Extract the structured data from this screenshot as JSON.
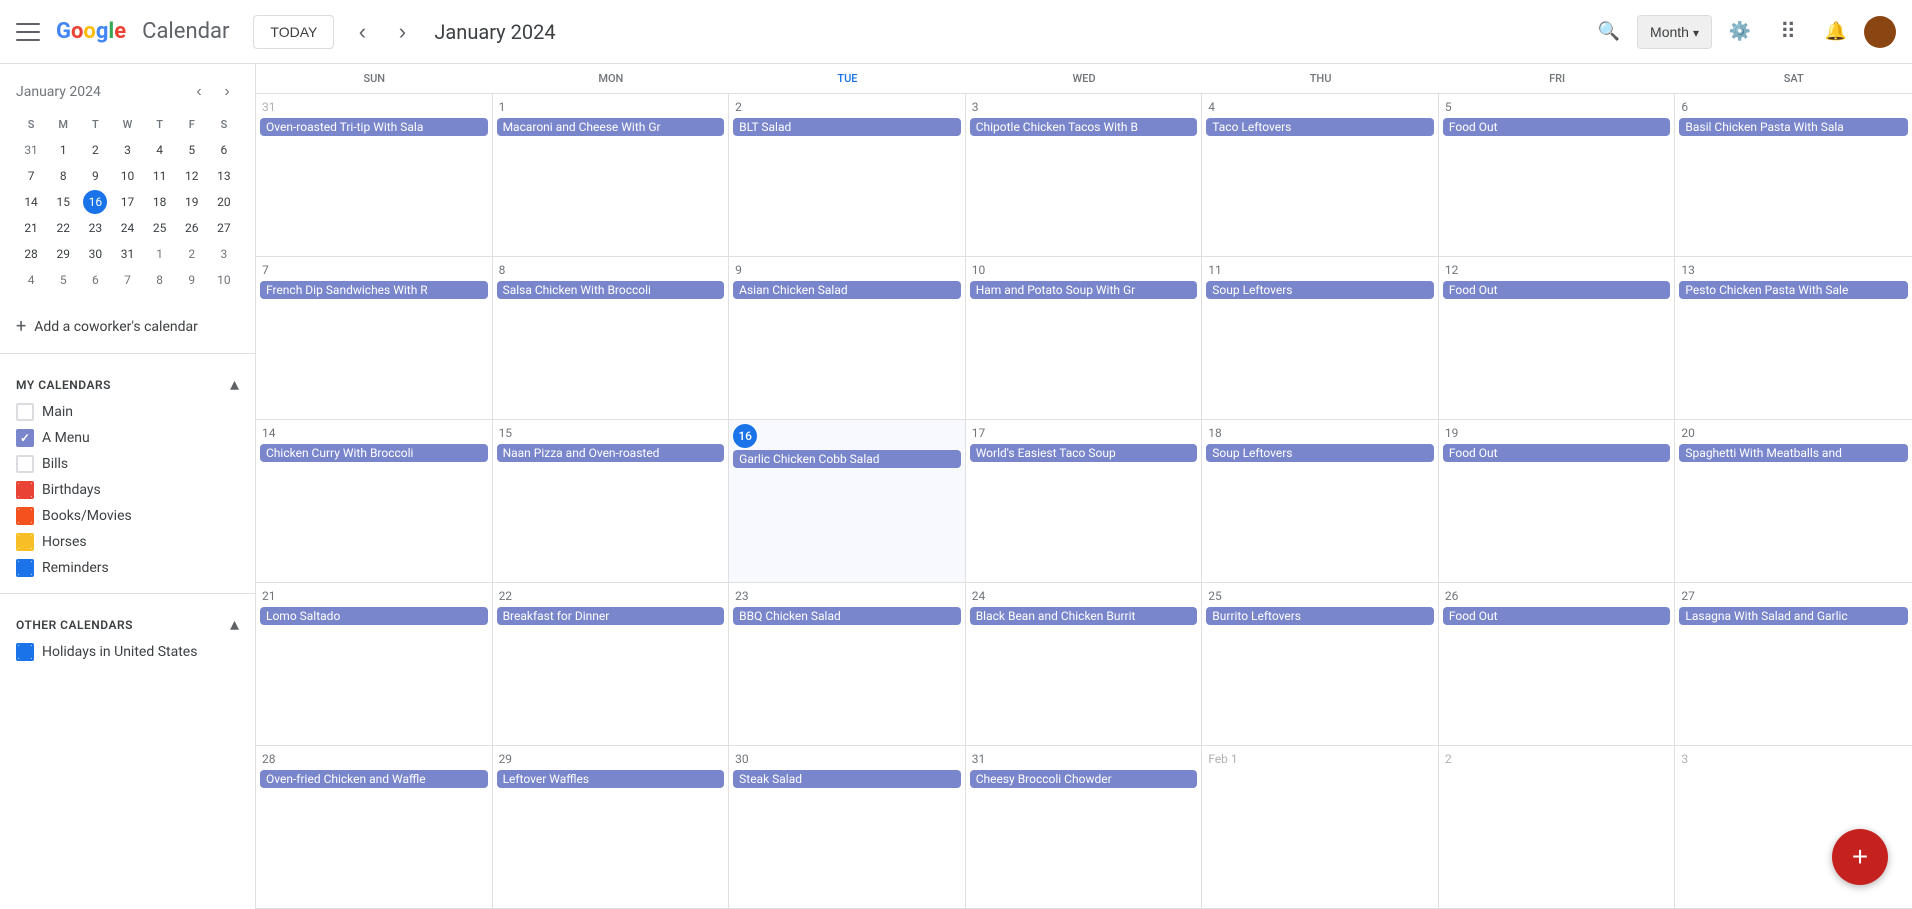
{
  "app": {
    "name": "Calendar",
    "today_btn": "TODAY"
  },
  "header": {
    "month_selector": "Month",
    "month_dropdown_arrow": "▾"
  },
  "mini_calendar": {
    "title": "January 2024",
    "days_of_week": [
      "S",
      "M",
      "T",
      "W",
      "T",
      "F",
      "S"
    ],
    "weeks": [
      [
        {
          "num": "31",
          "other": true
        },
        {
          "num": "1"
        },
        {
          "num": "2"
        },
        {
          "num": "3"
        },
        {
          "num": "4"
        },
        {
          "num": "5"
        },
        {
          "num": "6"
        }
      ],
      [
        {
          "num": "7"
        },
        {
          "num": "8"
        },
        {
          "num": "9"
        },
        {
          "num": "10"
        },
        {
          "num": "11"
        },
        {
          "num": "12"
        },
        {
          "num": "13"
        }
      ],
      [
        {
          "num": "14"
        },
        {
          "num": "15"
        },
        {
          "num": "16",
          "today": true
        },
        {
          "num": "17"
        },
        {
          "num": "18"
        },
        {
          "num": "19"
        },
        {
          "num": "20"
        }
      ],
      [
        {
          "num": "21"
        },
        {
          "num": "22"
        },
        {
          "num": "23"
        },
        {
          "num": "24"
        },
        {
          "num": "25"
        },
        {
          "num": "26"
        },
        {
          "num": "27"
        }
      ],
      [
        {
          "num": "28"
        },
        {
          "num": "29"
        },
        {
          "num": "30"
        },
        {
          "num": "31"
        },
        {
          "num": "1",
          "other": true
        },
        {
          "num": "2",
          "other": true
        },
        {
          "num": "3",
          "other": true
        }
      ],
      [
        {
          "num": "4",
          "other": true
        },
        {
          "num": "5",
          "other": true
        },
        {
          "num": "6",
          "other": true
        },
        {
          "num": "7",
          "other": true
        },
        {
          "num": "8",
          "other": true
        },
        {
          "num": "9",
          "other": true
        },
        {
          "num": "10",
          "other": true
        }
      ]
    ]
  },
  "add_coworker_label": "Add a coworker's calendar",
  "my_calendars": {
    "section_title": "My calendars",
    "items": [
      {
        "label": "Main",
        "checked": false,
        "color": "blue"
      },
      {
        "label": "A Menu",
        "checked": true,
        "color": "purple"
      },
      {
        "label": "Bills",
        "checked": false,
        "color": "none"
      },
      {
        "label": "Birthdays",
        "checked": false,
        "color": "red"
      },
      {
        "label": "Books/Movies",
        "checked": false,
        "color": "orange"
      },
      {
        "label": "Horses",
        "checked": false,
        "color": "yellow"
      },
      {
        "label": "Reminders",
        "checked": false,
        "color": "blue2"
      }
    ]
  },
  "other_calendars": {
    "section_title": "Other calendars",
    "items": [
      {
        "label": "Holidays in United States",
        "checked": false,
        "color": "blue2"
      }
    ]
  },
  "calendar": {
    "month_label": "January 2024",
    "days_of_week": [
      {
        "label": "Sun",
        "today": false
      },
      {
        "label": "Mon",
        "today": false
      },
      {
        "label": "Tue",
        "today": true
      },
      {
        "label": "Wed",
        "today": false
      },
      {
        "label": "Thu",
        "today": false
      },
      {
        "label": "Fri",
        "today": false
      },
      {
        "label": "Sat",
        "today": false
      }
    ],
    "weeks": [
      {
        "cells": [
          {
            "date": "31",
            "other": true,
            "events": [
              {
                "title": "Oven-roasted Tri-tip With Sala"
              }
            ]
          },
          {
            "date": "1",
            "events": [
              {
                "title": "Macaroni and Cheese With Gr"
              }
            ]
          },
          {
            "date": "2",
            "events": [
              {
                "title": "BLT Salad"
              }
            ]
          },
          {
            "date": "3",
            "events": [
              {
                "title": "Chipotle Chicken Tacos With B"
              }
            ]
          },
          {
            "date": "4",
            "events": [
              {
                "title": "Taco Leftovers"
              }
            ]
          },
          {
            "date": "5",
            "events": [
              {
                "title": "Food Out"
              }
            ]
          },
          {
            "date": "6",
            "events": [
              {
                "title": "Basil Chicken Pasta With Sala"
              }
            ]
          }
        ]
      },
      {
        "cells": [
          {
            "date": "7",
            "events": [
              {
                "title": "French Dip Sandwiches With R"
              }
            ]
          },
          {
            "date": "8",
            "events": [
              {
                "title": "Salsa Chicken With Broccoli"
              }
            ]
          },
          {
            "date": "9",
            "events": [
              {
                "title": "Asian Chicken Salad"
              }
            ]
          },
          {
            "date": "10",
            "events": [
              {
                "title": "Ham and Potato Soup With Gr"
              }
            ]
          },
          {
            "date": "11",
            "events": [
              {
                "title": "Soup Leftovers"
              }
            ]
          },
          {
            "date": "12",
            "events": [
              {
                "title": "Food Out"
              }
            ]
          },
          {
            "date": "13",
            "events": [
              {
                "title": "Pesto Chicken Pasta With Sale"
              }
            ]
          }
        ]
      },
      {
        "cells": [
          {
            "date": "14",
            "events": [
              {
                "title": "Chicken Curry With Broccoli"
              }
            ]
          },
          {
            "date": "15",
            "events": [
              {
                "title": "Naan Pizza and Oven-roasted"
              }
            ]
          },
          {
            "date": "16",
            "today": true,
            "events": [
              {
                "title": "Garlic Chicken Cobb Salad"
              }
            ]
          },
          {
            "date": "17",
            "events": [
              {
                "title": "World's Easiest Taco Soup"
              }
            ]
          },
          {
            "date": "18",
            "events": [
              {
                "title": "Soup Leftovers"
              }
            ]
          },
          {
            "date": "19",
            "events": [
              {
                "title": "Food Out"
              }
            ]
          },
          {
            "date": "20",
            "events": [
              {
                "title": "Spaghetti With Meatballs and"
              }
            ]
          }
        ]
      },
      {
        "cells": [
          {
            "date": "21",
            "events": [
              {
                "title": "Lomo Saltado"
              }
            ]
          },
          {
            "date": "22",
            "events": [
              {
                "title": "Breakfast for Dinner"
              }
            ]
          },
          {
            "date": "23",
            "events": [
              {
                "title": "BBQ Chicken Salad"
              }
            ]
          },
          {
            "date": "24",
            "events": [
              {
                "title": "Black Bean and Chicken Burrit"
              }
            ]
          },
          {
            "date": "25",
            "events": [
              {
                "title": "Burrito Leftovers"
              }
            ]
          },
          {
            "date": "26",
            "events": [
              {
                "title": "Food Out"
              }
            ]
          },
          {
            "date": "27",
            "events": [
              {
                "title": "Lasagna With Salad and Garlic"
              }
            ]
          }
        ]
      },
      {
        "cells": [
          {
            "date": "28",
            "events": [
              {
                "title": "Oven-fried Chicken and Waffle"
              }
            ]
          },
          {
            "date": "29",
            "events": [
              {
                "title": "Leftover Waffles"
              }
            ]
          },
          {
            "date": "30",
            "events": [
              {
                "title": "Steak Salad"
              }
            ]
          },
          {
            "date": "31",
            "events": [
              {
                "title": "Cheesy Broccoli Chowder"
              }
            ]
          },
          {
            "date": "Feb 1",
            "other": true,
            "events": []
          },
          {
            "date": "2",
            "other": true,
            "events": []
          },
          {
            "date": "3",
            "other": true,
            "events": []
          }
        ]
      }
    ]
  },
  "fab_label": "+"
}
